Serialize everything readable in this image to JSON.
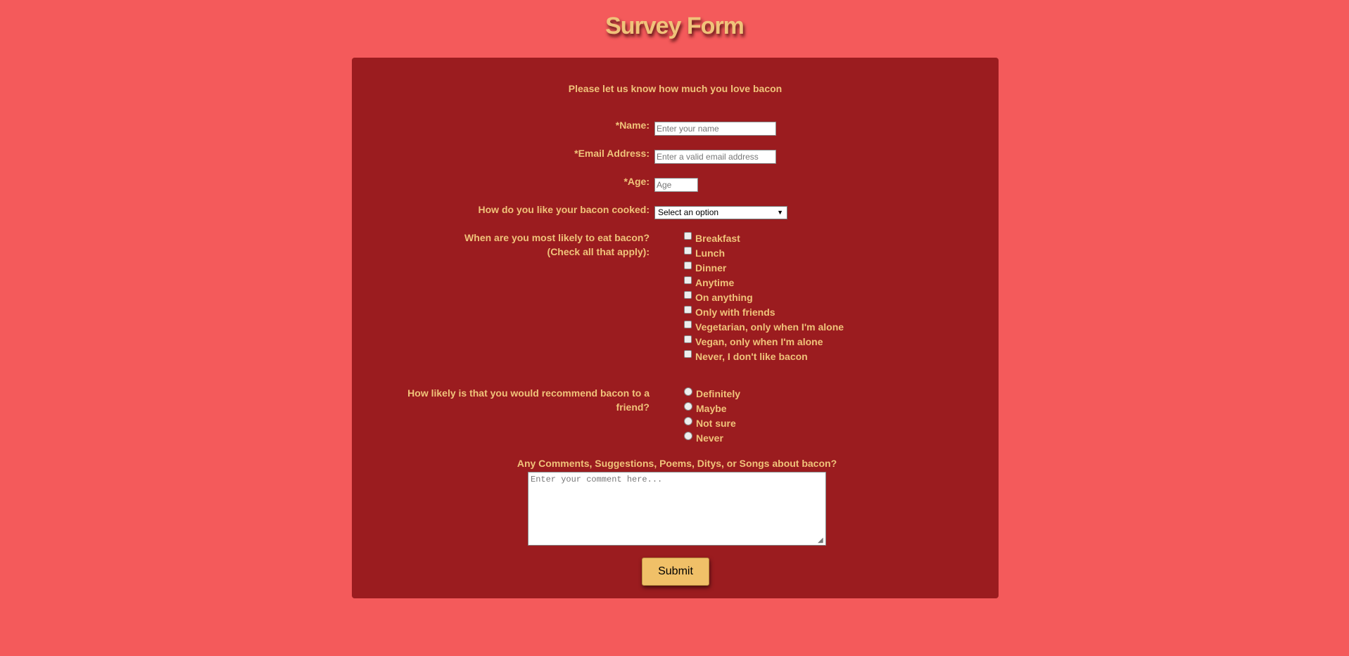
{
  "page": {
    "title": "Survey Form"
  },
  "form": {
    "intro": "Please let us know how much you love bacon",
    "name": {
      "label": "*Name:",
      "placeholder": "Enter your name"
    },
    "email": {
      "label": "*Email Address:",
      "placeholder": "Enter a valid email address"
    },
    "age": {
      "label": "*Age:",
      "placeholder": "Age"
    },
    "cooked": {
      "label": "How do you like your bacon cooked:",
      "selected": "Select an option"
    },
    "when": {
      "label_line1": "When are you most likely to eat bacon?",
      "label_line2": "(Check all that apply):",
      "options": [
        "Breakfast",
        "Lunch",
        "Dinner",
        "Anytime",
        "On anything",
        "Only with friends",
        "Vegetarian, only when I'm alone",
        "Vegan, only when I'm alone",
        "Never, I don't like bacon"
      ]
    },
    "recommend": {
      "label_line1": "How likely is that you would recommend bacon to a",
      "label_line2": "friend?",
      "options": [
        "Definitely",
        "Maybe",
        "Not sure",
        "Never"
      ]
    },
    "comments": {
      "label": "Any Comments, Suggestions, Poems, Ditys, or Songs about bacon?",
      "placeholder": "Enter your comment here..."
    },
    "submit_label": "Submit"
  },
  "colors": {
    "background": "#f45a5b",
    "card": "#9b1c1f",
    "accent": "#f0c37a"
  }
}
